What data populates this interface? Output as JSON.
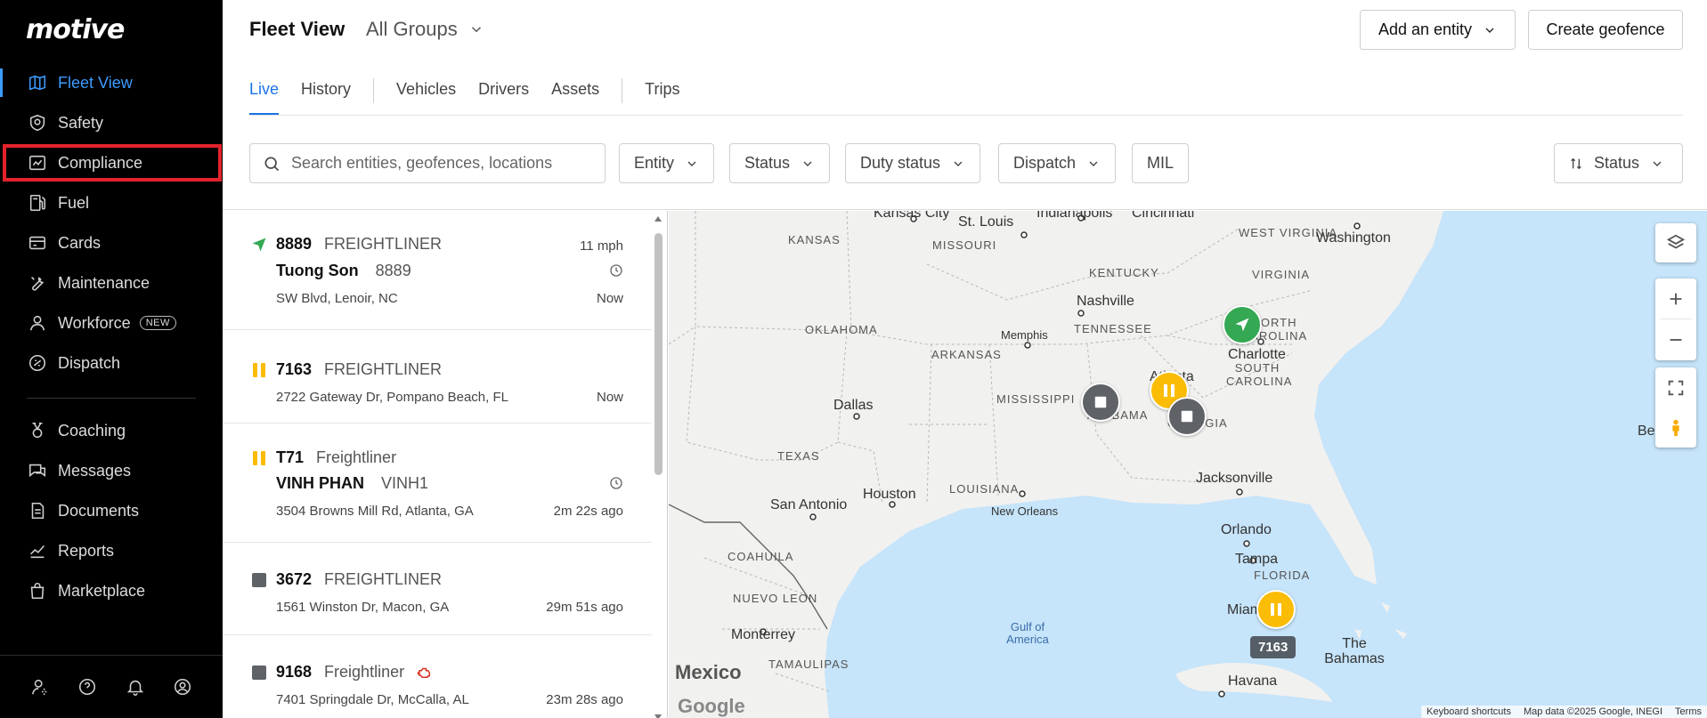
{
  "app": {
    "logo": "motive"
  },
  "sidebar": {
    "items": [
      {
        "label": "Fleet View",
        "icon": "map-icon"
      },
      {
        "label": "Safety",
        "icon": "shield-icon"
      },
      {
        "label": "Compliance",
        "icon": "chart-icon"
      },
      {
        "label": "Fuel",
        "icon": "fuel-icon"
      },
      {
        "label": "Cards",
        "icon": "card-icon"
      },
      {
        "label": "Maintenance",
        "icon": "wrench-icon"
      },
      {
        "label": "Workforce",
        "icon": "person-icon",
        "badge": "NEW"
      },
      {
        "label": "Dispatch",
        "icon": "dispatch-icon"
      },
      {
        "label": "Coaching",
        "icon": "medal-icon"
      },
      {
        "label": "Messages",
        "icon": "messages-icon"
      },
      {
        "label": "Documents",
        "icon": "document-icon"
      },
      {
        "label": "Reports",
        "icon": "reports-icon"
      },
      {
        "label": "Marketplace",
        "icon": "bag-icon"
      }
    ],
    "bottom_icons": [
      "user-settings-icon",
      "help-icon",
      "bell-icon",
      "account-icon"
    ]
  },
  "header": {
    "title": "Fleet View",
    "group": "All Groups",
    "add_entity": "Add an entity",
    "create_geofence": "Create geofence",
    "tabs": [
      "Live",
      "History",
      "Vehicles",
      "Drivers",
      "Assets",
      "Trips"
    ],
    "search_placeholder": "Search entities, geofences, locations",
    "filters": [
      "Entity",
      "Status",
      "Duty status",
      "Dispatch",
      "MIL"
    ],
    "sort": "Status"
  },
  "list": {
    "items": [
      {
        "unit": "8889",
        "make": "FREIGHTLINER",
        "driver": "Tuong Son",
        "driver_id": "8889",
        "address": "SW Blvd, Lenoir, NC",
        "speed": "11 mph",
        "time": "Now",
        "status": "moving"
      },
      {
        "unit": "7163",
        "make": "FREIGHTLINER",
        "address": "2722 Gateway Dr, Pompano Beach, FL",
        "time": "Now",
        "status": "idle"
      },
      {
        "unit": "T71",
        "make": "Freightliner",
        "driver": "VINH PHAN",
        "driver_id": "VINH1",
        "address": "3504 Browns Mill Rd, Atlanta, GA",
        "time": "2m 22s ago",
        "status": "idle"
      },
      {
        "unit": "3672",
        "make": "FREIGHTLINER",
        "address": "1561 Winston Dr, Macon, GA",
        "time": "29m 51s ago",
        "status": "stopped"
      },
      {
        "unit": "9168",
        "make": "Freightliner",
        "address": "7401 Springdale Dr, McCalla, AL",
        "time": "23m 28s ago",
        "status": "stopped",
        "alert": "engine-icon"
      }
    ]
  },
  "map": {
    "states": [
      "KANSAS",
      "MISSOURI",
      "KENTUCKY",
      "WEST VIRGINIA",
      "VIRGINIA",
      "OKLAHOMA",
      "TENNESSEE",
      "NORTH CAROLINA",
      "ARKANSAS",
      "SOUTH CAROLINA",
      "MISSISSIPPI",
      "ALABAMA",
      "GEORGIA",
      "TEXAS",
      "LOUISIANA",
      "FLORIDA",
      "COAHUILA",
      "NUEVO LEON",
      "TAMAULIPAS"
    ],
    "cities": [
      "Kansas City",
      "St. Louis",
      "Indianapolis",
      "Cincinnati",
      "Washington",
      "Nashville",
      "Memphis",
      "Charlotte",
      "Atlanta",
      "Dallas",
      "Jacksonville",
      "San Antonio",
      "Houston",
      "New Orleans",
      "Orlando",
      "Tampa",
      "Miami",
      "Monterrey",
      "Havana",
      "The Bahamas",
      "Bermuda"
    ],
    "water": "Gulf of America",
    "country": "Mexico",
    "marker_tag": "7163",
    "footer": [
      "Keyboard shortcuts",
      "Map data ©2025 Google, INEGI",
      "Terms"
    ],
    "google": "Google",
    "colors": {
      "moving": "#34a853",
      "idle": "#fbbc05",
      "stopped": "#5f6368",
      "water": "#c6e4fa",
      "accent": "#1a73e8"
    }
  }
}
